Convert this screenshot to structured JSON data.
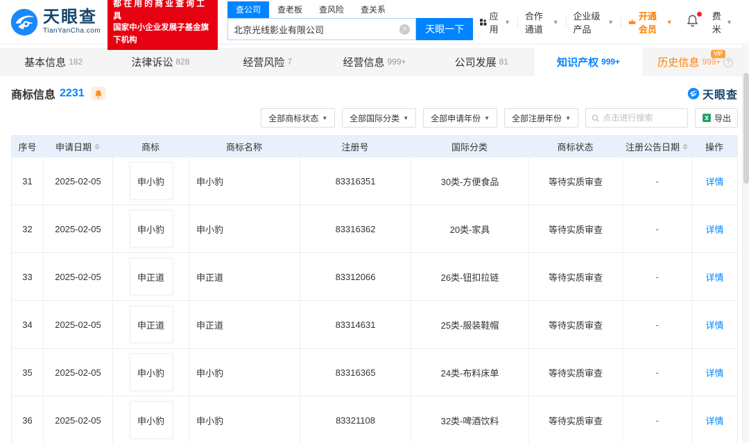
{
  "brand": {
    "logo_text": "天眼查",
    "logo_domain": "TianYanCha.com",
    "promo_line1": "都在用的商业查询工具",
    "promo_line2": "国家中小企业发展子基金旗下机构",
    "mini_logo_text": "天眼查"
  },
  "search": {
    "tabs": [
      {
        "label": "查公司",
        "active": true
      },
      {
        "label": "查老板",
        "active": false
      },
      {
        "label": "查风险",
        "active": false
      },
      {
        "label": "查关系",
        "active": false
      }
    ],
    "value": "北京光线影业有限公司",
    "button": "天眼一下"
  },
  "topnav": {
    "apps": "应用",
    "partner": "合作通道",
    "enterprise": "企业级产品",
    "vip": "开通会员",
    "user": "费米"
  },
  "tabs": [
    {
      "label": "基本信息",
      "count": "182"
    },
    {
      "label": "法律诉讼",
      "count": "828"
    },
    {
      "label": "经营风险",
      "count": "7"
    },
    {
      "label": "经营信息",
      "count": "999+"
    },
    {
      "label": "公司发展",
      "count": "81"
    },
    {
      "label": "知识产权",
      "count": "999+",
      "active": true
    },
    {
      "label": "历史信息",
      "count": "999+",
      "vip": true
    }
  ],
  "vip_badge": "VIP",
  "section": {
    "title": "商标信息",
    "count": "2231"
  },
  "filters": {
    "dropdowns": [
      "全部商标状态",
      "全部国际分类",
      "全部申请年份",
      "全部注册年份"
    ],
    "search_placeholder": "点击进行搜索",
    "export_label": "导出"
  },
  "table": {
    "headers": [
      "序号",
      "申请日期",
      "商标",
      "商标名称",
      "注册号",
      "国际分类",
      "商标状态",
      "注册公告日期",
      "操作"
    ],
    "rows": [
      {
        "no": "31",
        "date": "2025-02-05",
        "mark": "申小豹",
        "name": "申小豹",
        "reg_no": "83316351",
        "class": "30类-方便食品",
        "status": "等待实质审查",
        "pub_date": "-",
        "action": "详情"
      },
      {
        "no": "32",
        "date": "2025-02-05",
        "mark": "申小豹",
        "name": "申小豹",
        "reg_no": "83316362",
        "class": "20类-家具",
        "status": "等待实质审查",
        "pub_date": "-",
        "action": "详情"
      },
      {
        "no": "33",
        "date": "2025-02-05",
        "mark": "申正道",
        "name": "申正道",
        "reg_no": "83312066",
        "class": "26类-钮扣拉链",
        "status": "等待实质审查",
        "pub_date": "-",
        "action": "详情"
      },
      {
        "no": "34",
        "date": "2025-02-05",
        "mark": "申正道",
        "name": "申正道",
        "reg_no": "83314631",
        "class": "25类-服装鞋帽",
        "status": "等待实质审查",
        "pub_date": "-",
        "action": "详情"
      },
      {
        "no": "35",
        "date": "2025-02-05",
        "mark": "申小豹",
        "name": "申小豹",
        "reg_no": "83316365",
        "class": "24类-布料床单",
        "status": "等待实质审查",
        "pub_date": "-",
        "action": "详情"
      },
      {
        "no": "36",
        "date": "2025-02-05",
        "mark": "申小豹",
        "name": "申小豹",
        "reg_no": "83321108",
        "class": "32类-啤酒饮料",
        "status": "等待实质审查",
        "pub_date": "-",
        "action": "详情"
      }
    ]
  },
  "colors": {
    "brand_blue": "#0084ff",
    "brand_navy": "#17456e",
    "promo_red": "#e60012",
    "vip_orange": "#ff8000",
    "table_header_bg": "#e8f1fb",
    "export_green": "#21a366"
  }
}
